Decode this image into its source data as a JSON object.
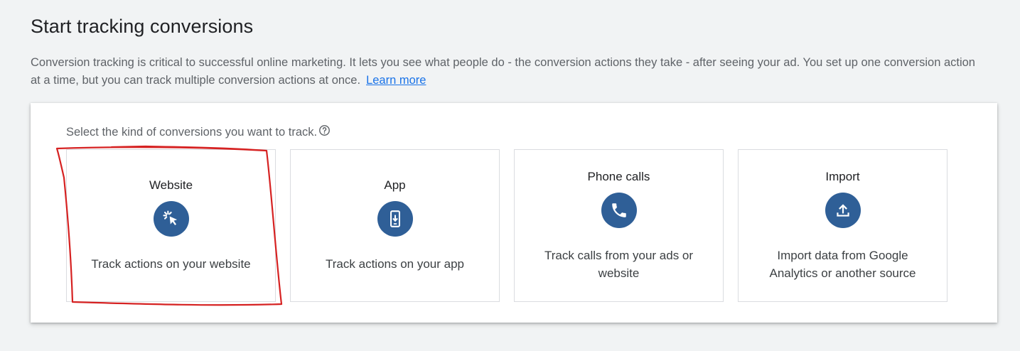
{
  "header": {
    "title": "Start tracking conversions",
    "description": "Conversion tracking is critical to successful online marketing. It lets you see what people do - the conversion actions they take - after seeing your ad. You set up one conversion action at a time, but you can track multiple conversion actions at once.",
    "learn_more": "Learn more"
  },
  "panel": {
    "prompt": "Select the kind of conversions you want to track.",
    "cards": [
      {
        "title": "Website",
        "icon": "cursor-click-icon",
        "description": "Track actions on your website"
      },
      {
        "title": "App",
        "icon": "phone-download-icon",
        "description": "Track actions on your app"
      },
      {
        "title": "Phone calls",
        "icon": "phone-call-icon",
        "description": "Track calls from your ads or website"
      },
      {
        "title": "Import",
        "icon": "upload-icon",
        "description": "Import data from Google Analytics or another source"
      }
    ]
  },
  "colors": {
    "icon_circle": "#2f5f97",
    "link": "#1a73e8",
    "annotation": "#d62222"
  }
}
